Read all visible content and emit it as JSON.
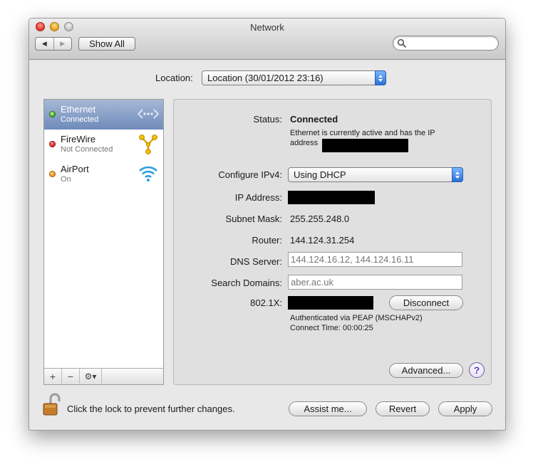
{
  "window": {
    "title": "Network"
  },
  "toolbar": {
    "back_glyph": "◀",
    "forward_glyph": "▶",
    "show_all_label": "Show All",
    "search_placeholder": "",
    "search_value": ""
  },
  "location": {
    "label": "Location:",
    "value": "Location (30/01/2012 23:16)"
  },
  "services": [
    {
      "name": "Ethernet",
      "status": "Connected",
      "indicator": "green",
      "icon": "ethernet-icon",
      "selected": true
    },
    {
      "name": "FireWire",
      "status": "Not Connected",
      "indicator": "red",
      "icon": "firewire-icon",
      "selected": false
    },
    {
      "name": "AirPort",
      "status": "On",
      "indicator": "orange",
      "icon": "airport-wifi-icon",
      "selected": false
    }
  ],
  "list_actions": {
    "add": "+",
    "remove": "−",
    "gear": "⚙▾"
  },
  "details": {
    "status_label": "Status:",
    "status_value": "Connected",
    "status_desc_line1": "Ethernet is currently active and has the IP",
    "status_desc_line2": "address",
    "configure_label": "Configure IPv4:",
    "configure_value": "Using DHCP",
    "ip_label": "IP Address:",
    "subnet_label": "Subnet Mask:",
    "subnet_value": "255.255.248.0",
    "router_label": "Router:",
    "router_value": "144.124.31.254",
    "dns_label": "DNS Server:",
    "dns_value": "144.124.16.12, 144.124.16.11",
    "search_domains_label": "Search Domains:",
    "search_domains_value": "aber.ac.uk",
    "dot1x_label": "802.1X:",
    "disconnect_label": "Disconnect",
    "auth_text": "Authenticated via PEAP (MSCHAPv2)",
    "connect_time_text": "Connect Time: 00:00:25",
    "advanced_label": "Advanced...",
    "help_label": "?"
  },
  "footer": {
    "lock_text": "Click the lock to prevent further changes.",
    "assist_label": "Assist me...",
    "revert_label": "Revert",
    "apply_label": "Apply"
  },
  "colors": {
    "selection": "#7f98c4",
    "popup_arrow": "#2b6fd8",
    "window_bg": "#e8e8e8"
  }
}
